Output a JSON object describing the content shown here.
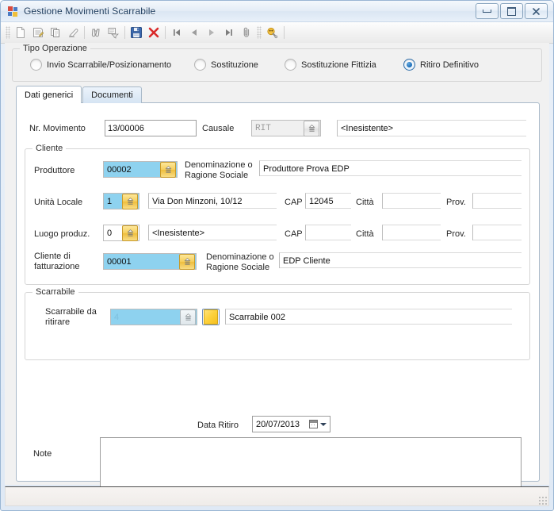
{
  "window": {
    "title": "Gestione Movimenti Scarrabile",
    "app_icon": "windows-forms-icon",
    "buttons": {
      "minimize": "minimize-icon",
      "maximize": "maximize-icon",
      "close": "close-icon"
    }
  },
  "toolbar": {
    "items": [
      {
        "name": "new-record-button",
        "icon": "new-document-icon"
      },
      {
        "name": "edit-record-button",
        "icon": "edit-document-icon"
      },
      {
        "name": "copy-record-button",
        "icon": "copy-icon"
      },
      {
        "name": "clear-record-button",
        "icon": "eraser-icon"
      },
      {
        "name": "find-button",
        "icon": "binoculars-icon"
      },
      {
        "name": "find-advanced-button",
        "icon": "find-filter-icon"
      },
      {
        "name": "save-button",
        "icon": "floppy-save-icon"
      },
      {
        "name": "delete-button",
        "icon": "red-x-delete-icon"
      },
      {
        "name": "first-record-button",
        "icon": "nav-first-icon"
      },
      {
        "name": "prev-record-button",
        "icon": "nav-prev-icon"
      },
      {
        "name": "next-record-button",
        "icon": "nav-next-icon"
      },
      {
        "name": "last-record-button",
        "icon": "nav-last-icon"
      },
      {
        "name": "attachments-button",
        "icon": "paperclip-icon"
      },
      {
        "name": "tools-button",
        "icon": "yellow-tools-icon"
      }
    ]
  },
  "operation_group": {
    "title": "Tipo Operazione",
    "options": [
      {
        "label": "Invio Scarrabile/Posizionamento",
        "checked": false
      },
      {
        "label": "Sostituzione",
        "checked": false
      },
      {
        "label": "Sostituzione Fittizia",
        "checked": false
      },
      {
        "label": "Ritiro Definitivo",
        "checked": true
      }
    ]
  },
  "tabs": [
    {
      "label": "Dati generici",
      "active": true
    },
    {
      "label": "Documenti",
      "active": false
    }
  ],
  "form": {
    "nr_movimento": {
      "label": "Nr. Movimento",
      "value": "13/00006"
    },
    "causale": {
      "label": "Causale",
      "value": "RIT",
      "description": "<Inesistente>",
      "button_icon": "lookup-icon"
    },
    "cliente_group": {
      "title": "Cliente",
      "produttore": {
        "label": "Produttore",
        "code": "00002",
        "desc_label": "Denominazione o\nRagione Sociale",
        "description": "Produttore Prova EDP",
        "button_icon": "lookup-icon"
      },
      "unita_locale": {
        "label": "Unità Locale",
        "code": "1",
        "address": "Via Don Minzoni, 10/12",
        "cap_label": "CAP",
        "cap": "12045",
        "citta_label": "Città",
        "citta": "",
        "prov_label": "Prov.",
        "prov": "",
        "button_icon": "lookup-icon"
      },
      "luogo_produz": {
        "label": "Luogo produz.",
        "code": "0",
        "description": "<Inesistente>",
        "cap_label": "CAP",
        "cap": "",
        "citta_label": "Città",
        "citta": "",
        "prov_label": "Prov.",
        "prov": "",
        "button_icon": "lookup-icon"
      },
      "cliente_fatturazione": {
        "label": "Cliente di\nfatturazione",
        "code": "00001",
        "desc_label": "Denominazione o\nRagione Sociale",
        "description": "EDP Cliente",
        "button_icon": "lookup-icon"
      }
    },
    "scarrabile_group": {
      "title": "Scarrabile",
      "scarrabile_da_ritirare": {
        "label": "Scarrabile da\nritirare",
        "code": "4",
        "description": "Scarrabile 002",
        "button_icon": "lookup-icon",
        "picker_icon": "yellow-container-icon"
      }
    },
    "data_ritiro": {
      "label": "Data Ritiro",
      "value": "20/07/2013",
      "calendar_icon": "calendar-icon",
      "dropdown_icon": "chevron-down-icon"
    },
    "note": {
      "label": "Note",
      "value": "",
      "placeholder": ""
    }
  },
  "statusbar": {
    "text": "",
    "grip_icon": "resize-grip-icon"
  },
  "colors": {
    "accent_field": "#8ed2ef",
    "lookup_button": "#f6cf5d",
    "save_icon": "#2f5fa8",
    "delete_icon": "#d92a2a",
    "radio_checked": "#1b6cb5"
  }
}
